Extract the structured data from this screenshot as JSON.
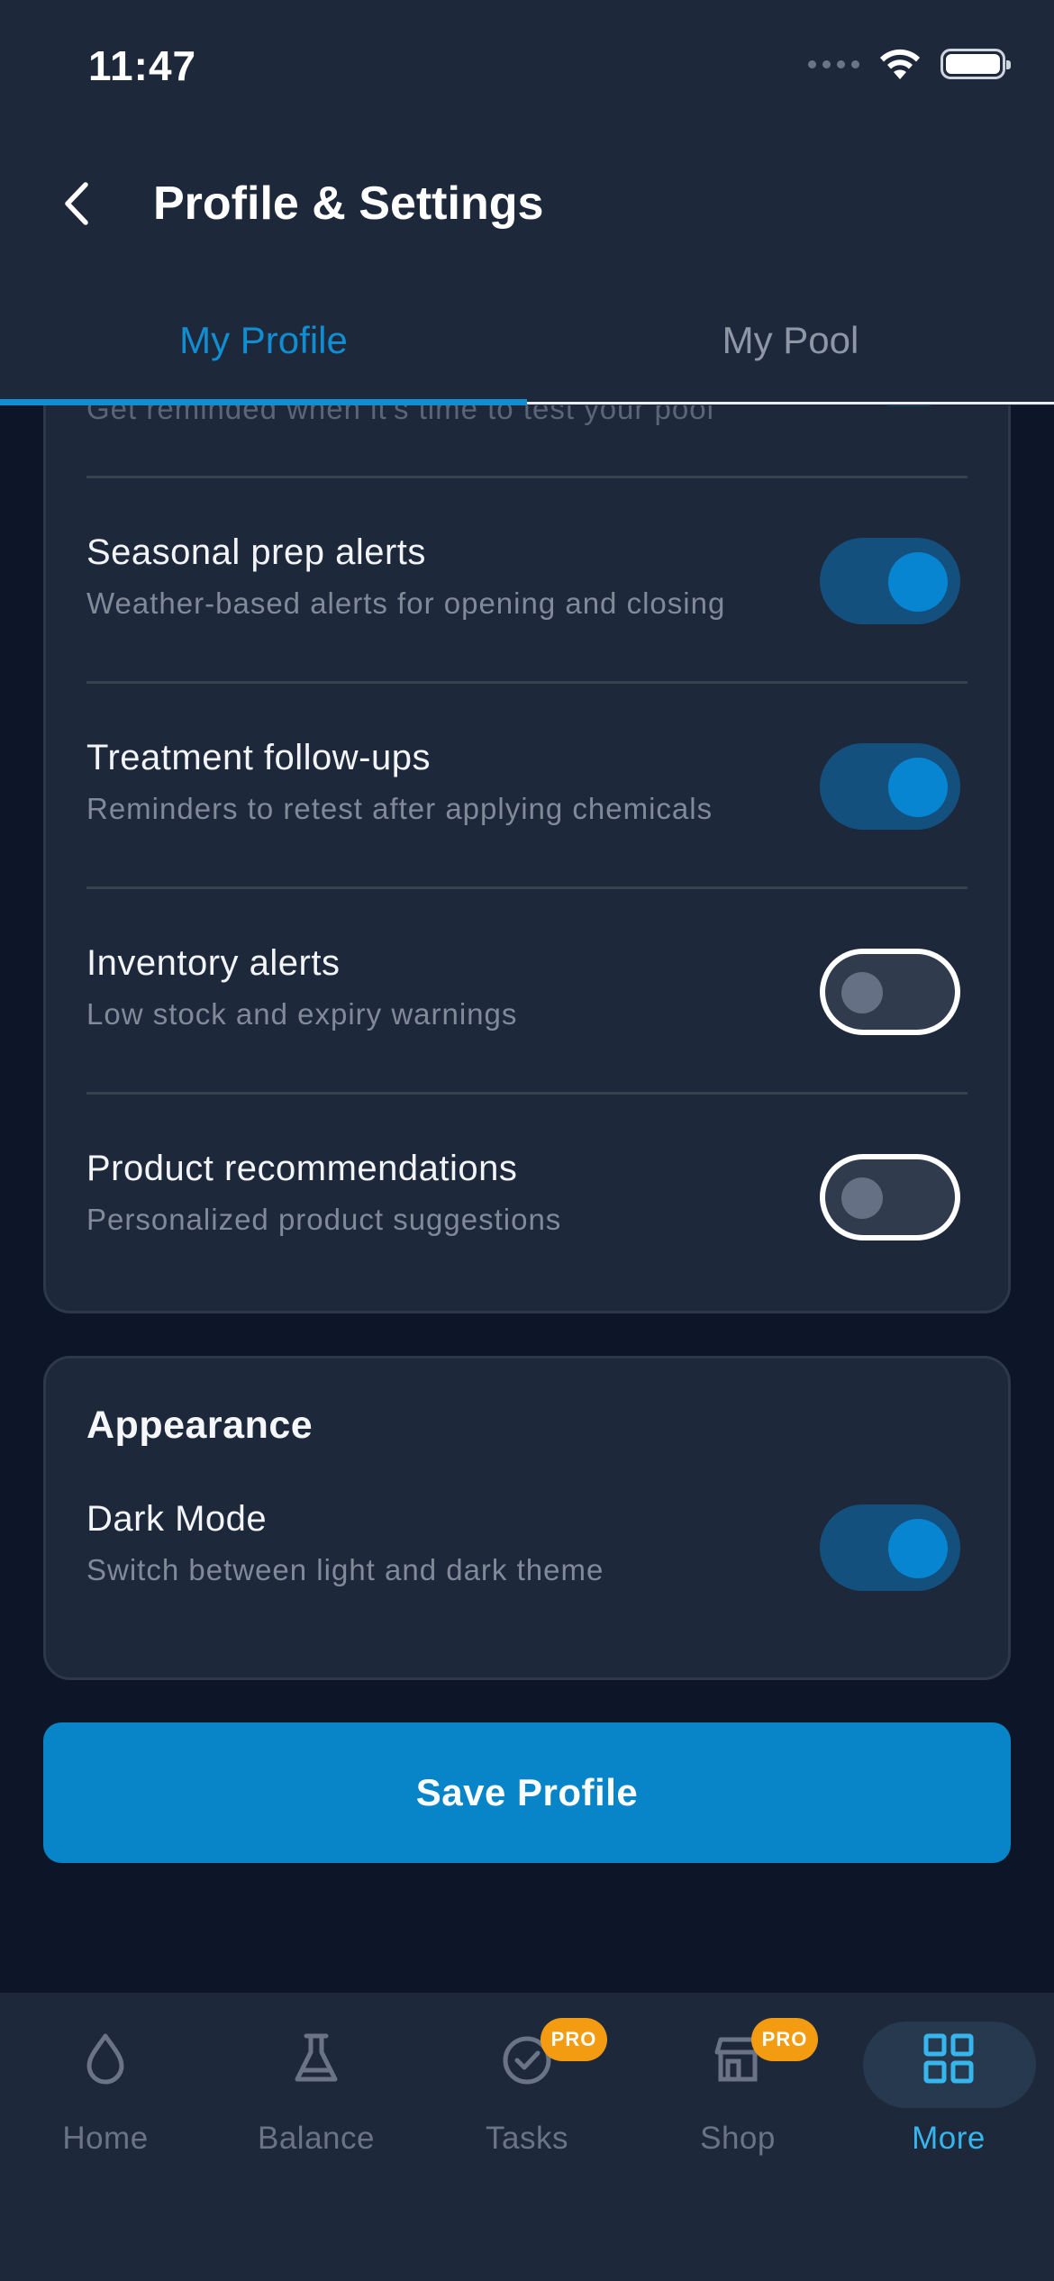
{
  "status_bar": {
    "time": "11:47"
  },
  "header": {
    "title": "Profile & Settings"
  },
  "tabs": [
    {
      "label": "My Profile",
      "active": true
    },
    {
      "label": "My Pool",
      "active": false
    }
  ],
  "notifications": {
    "partial_row_subtitle": "Get reminded when it's time to test your pool",
    "items": [
      {
        "title": "Seasonal prep alerts",
        "subtitle": "Weather-based alerts for opening and closing",
        "enabled": true
      },
      {
        "title": "Treatment follow-ups",
        "subtitle": "Reminders to retest after applying chemicals",
        "enabled": true
      },
      {
        "title": "Inventory alerts",
        "subtitle": "Low stock and expiry warnings",
        "enabled": false
      },
      {
        "title": "Product recommendations",
        "subtitle": "Personalized product suggestions",
        "enabled": false
      }
    ]
  },
  "appearance": {
    "title": "Appearance",
    "dark_mode": {
      "title": "Dark Mode",
      "subtitle": "Switch between light and dark theme",
      "enabled": true
    }
  },
  "save_button": {
    "label": "Save Profile"
  },
  "bottom_nav": {
    "items": [
      {
        "label": "Home",
        "icon": "water-drop-icon"
      },
      {
        "label": "Balance",
        "icon": "flask-icon"
      },
      {
        "label": "Tasks",
        "icon": "check-circle-icon",
        "badge": "PRO"
      },
      {
        "label": "Shop",
        "icon": "store-icon",
        "badge": "PRO"
      },
      {
        "label": "More",
        "icon": "grid-icon",
        "active": true
      }
    ]
  },
  "colors": {
    "accent": "#118ed2",
    "background": "#0d1628",
    "surface": "#1e283b",
    "badge": "#f39c12",
    "nav_active": "#37b6ee"
  }
}
